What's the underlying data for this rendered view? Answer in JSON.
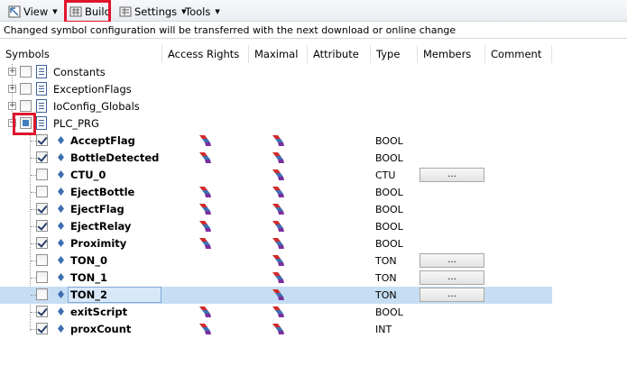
{
  "toolbar": {
    "view_label": "View",
    "build_label": "Build",
    "settings_label": "Settings",
    "tools_label": "Tools"
  },
  "infobar": {
    "message": "Changed symbol configuration will be transferred with the next download or online change"
  },
  "columns": [
    "Symbols",
    "Access Rights",
    "Maximal",
    "Attribute",
    "Type",
    "Members",
    "Comment"
  ],
  "groups": [
    {
      "label": "Constants",
      "expanded": false
    },
    {
      "label": "ExceptionFlags",
      "expanded": false
    },
    {
      "label": "IoConfig_Globals",
      "expanded": false
    },
    {
      "label": "PLC_PRG",
      "expanded": true
    }
  ],
  "members_button_label": "...",
  "variables": [
    {
      "name": "AcceptFlag",
      "checked": true,
      "access": true,
      "type": "BOOL",
      "members": false
    },
    {
      "name": "BottleDetected",
      "checked": true,
      "access": true,
      "type": "BOOL",
      "members": false
    },
    {
      "name": "CTU_0",
      "checked": false,
      "access": false,
      "type": "CTU",
      "members": true
    },
    {
      "name": "EjectBottle",
      "checked": false,
      "access": true,
      "type": "BOOL",
      "members": false
    },
    {
      "name": "EjectFlag",
      "checked": true,
      "access": true,
      "type": "BOOL",
      "members": false
    },
    {
      "name": "EjectRelay",
      "checked": true,
      "access": true,
      "type": "BOOL",
      "members": false
    },
    {
      "name": "Proximity",
      "checked": true,
      "access": true,
      "type": "BOOL",
      "members": false
    },
    {
      "name": "TON_0",
      "checked": false,
      "access": false,
      "type": "TON",
      "members": true
    },
    {
      "name": "TON_1",
      "checked": false,
      "access": false,
      "type": "TON",
      "members": true
    },
    {
      "name": "TON_2",
      "checked": false,
      "access": false,
      "type": "TON",
      "members": true
    },
    {
      "name": "exitScript",
      "checked": true,
      "access": true,
      "type": "BOOL",
      "members": false
    },
    {
      "name": "proxCount",
      "checked": true,
      "access": true,
      "type": "INT",
      "members": false
    }
  ],
  "selected_variable": "TON_2",
  "colors": {
    "highlight": "#e0152c",
    "selection": "#c6def3"
  }
}
